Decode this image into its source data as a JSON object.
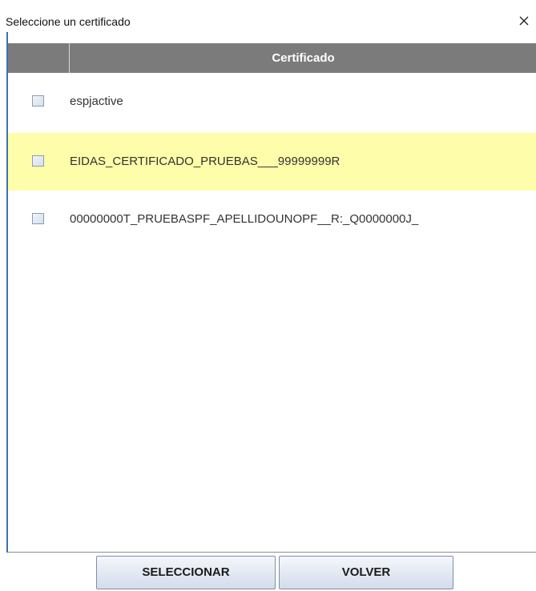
{
  "window": {
    "title": "Seleccione un certificado",
    "close_icon": "close-icon"
  },
  "table": {
    "column_header": "Certificado",
    "rows": [
      {
        "label": "espjactive",
        "checked": false,
        "highlighted": false
      },
      {
        "label": "EIDAS_CERTIFICADO_PRUEBAS___99999999R",
        "checked": false,
        "highlighted": true
      },
      {
        "label": "00000000T_PRUEBASPF_APELLIDOUNOPF__R:_Q0000000J_",
        "checked": false,
        "highlighted": false
      }
    ]
  },
  "buttons": {
    "select_label": "SELECCIONAR",
    "back_label": "VOLVER"
  },
  "colors": {
    "header_bg": "#7b7b7b",
    "highlight_row": "#fdfdaa",
    "frame_accent": "#3d6fb5"
  }
}
